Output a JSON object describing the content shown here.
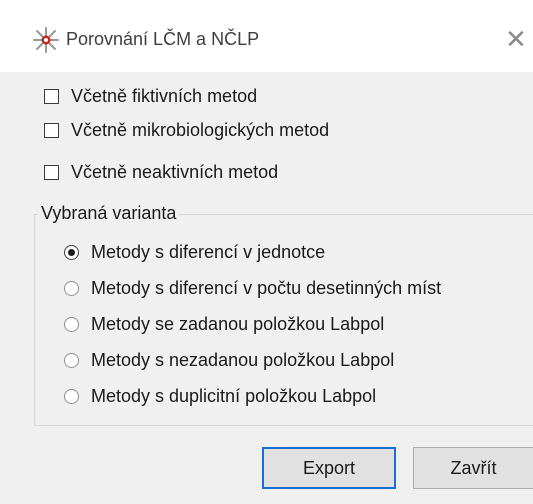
{
  "window": {
    "title": "Porovnání LČM a NČLP",
    "app_icon": "star-emblem-icon",
    "close_symbol": "✕"
  },
  "checkboxes": [
    {
      "label": "Včetně fiktivních metod",
      "checked": false
    },
    {
      "label": "Včetně mikrobiologických metod",
      "checked": false
    },
    {
      "label": "Včetně neaktivních metod",
      "checked": false
    }
  ],
  "variant_group": {
    "legend": "Vybraná varianta",
    "options": [
      {
        "label": "Metody s diferencí v jednotce",
        "selected": true
      },
      {
        "label": "Metody s diferencí v počtu desetinných míst",
        "selected": false
      },
      {
        "label": "Metody se zadanou položkou Labpol",
        "selected": false
      },
      {
        "label": "Metody s nezadanou položkou Labpol",
        "selected": false
      },
      {
        "label": "Metody s duplicitní položkou Labpol",
        "selected": false
      }
    ]
  },
  "buttons": {
    "export_label": "Export",
    "close_label": "Zavřít"
  },
  "colors": {
    "dialog_bg": "#f0f0f0",
    "titlebar_bg": "#ffffff",
    "default_button_border": "#1a6fd6",
    "icon_red": "#c42b1c"
  }
}
